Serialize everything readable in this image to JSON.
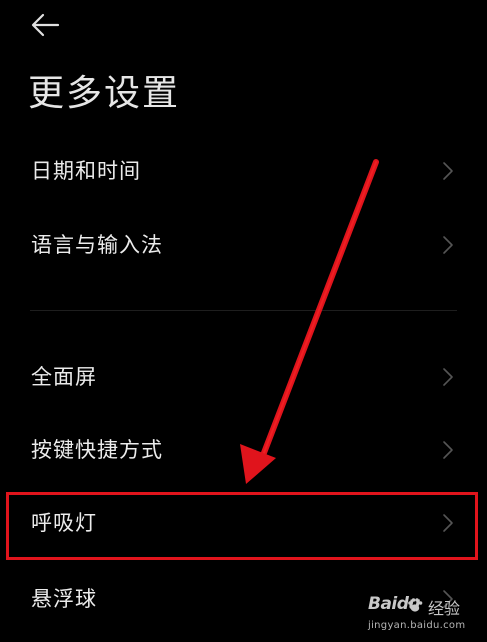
{
  "header": {
    "back_icon": "arrow-left-icon",
    "title": "更多设置"
  },
  "settings": {
    "items": [
      {
        "label": "日期和时间"
      },
      {
        "label": "语言与输入法"
      },
      {
        "label": "全面屏"
      },
      {
        "label": "按键快捷方式"
      },
      {
        "label": "呼吸灯"
      },
      {
        "label": "悬浮球"
      }
    ]
  },
  "annotation": {
    "highlight_color": "#e0141c",
    "arrow_color": "#e0141c"
  },
  "watermark": {
    "brand": "Baidu",
    "label": "经验",
    "url": "jingyan.baidu.com"
  }
}
